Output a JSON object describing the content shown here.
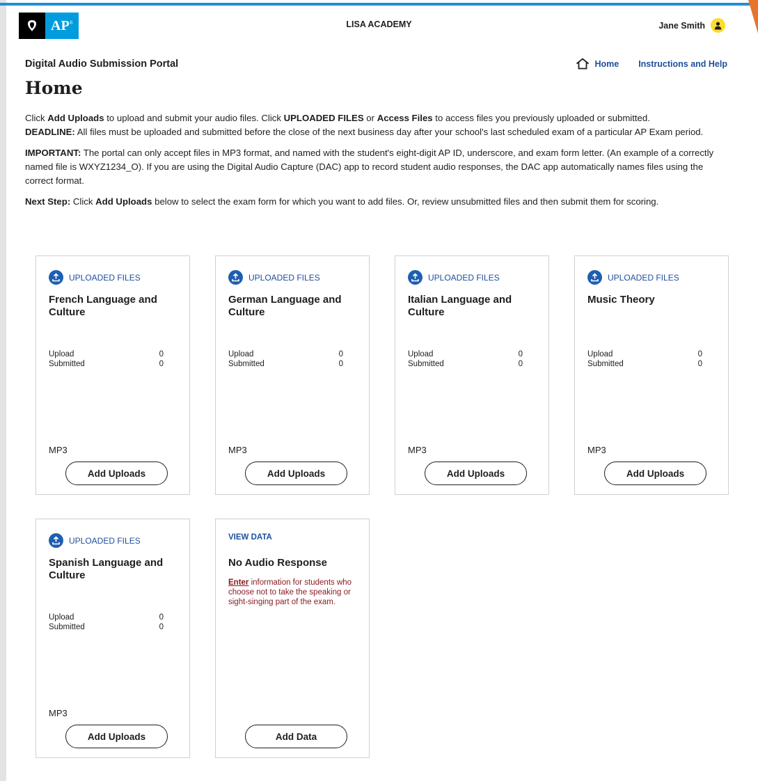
{
  "header": {
    "logo_ap": "AP",
    "logo_ap_mark": "®",
    "school": "LISA ACADEMY",
    "user_name": "Jane Smith",
    "avatar_icon": "user-icon"
  },
  "colors": {
    "top_bar": "#1d8fd8",
    "link": "#1f4e9d",
    "avatar": "#fddc2b",
    "tag_icon": "#1f5fb0",
    "description": "#8a1c24",
    "corner_accent": "#e8742c"
  },
  "portal_title": "Digital Audio Submission Portal",
  "nav": {
    "home": "Home",
    "help": "Instructions and Help"
  },
  "page_title": "Home",
  "intro": {
    "p1_a": "Click ",
    "p1_b": "Add Uploads",
    "p1_c": " to upload and submit your audio files. Click ",
    "p1_d": "UPLOADED FILES",
    "p1_e": " or ",
    "p1_f": "Access Files",
    "p1_g": " to access files you previously uploaded or submitted.",
    "p1_h": "DEADLINE:",
    "p1_i": " All files must be uploaded and submitted before the close of the next business day after your school's last scheduled exam of a particular AP Exam period.",
    "p2_a": "IMPORTANT:",
    "p2_b": " The portal can only accept files in MP3 format, and named with the student's eight-digit AP ID, underscore, and exam form letter. (An example of a correctly named file is WXYZ1234_O). If you are using the Digital Audio Capture (DAC) app to record student audio responses, the DAC app automatically names files using the correct format.",
    "p3_a": "Next Step:",
    "p3_b": " Click ",
    "p3_c": "Add Uploads",
    "p3_d": " below to select the exam form for which you want to add files. Or, review unsubmitted files and then submit them for scoring."
  },
  "cards": [
    {
      "tag": "UPLOADED FILES",
      "title": "French Language and Culture",
      "upload_label": "Upload",
      "upload_value": "0",
      "submitted_label": "Submitted",
      "submitted_value": "0",
      "format": "MP3",
      "button": "Add Uploads"
    },
    {
      "tag": "UPLOADED FILES",
      "title": "German Language and Culture",
      "upload_label": "Upload",
      "upload_value": "0",
      "submitted_label": "Submitted",
      "submitted_value": "0",
      "format": "MP3",
      "button": "Add Uploads"
    },
    {
      "tag": "UPLOADED FILES",
      "title": "Italian Language and Culture",
      "upload_label": "Upload",
      "upload_value": "0",
      "submitted_label": "Submitted",
      "submitted_value": "0",
      "format": "MP3",
      "button": "Add Uploads"
    },
    {
      "tag": "UPLOADED FILES",
      "title": "Music Theory",
      "upload_label": "Upload",
      "upload_value": "0",
      "submitted_label": "Submitted",
      "submitted_value": "0",
      "format": "MP3",
      "button": "Add Uploads"
    },
    {
      "tag": "UPLOADED FILES",
      "title": "Spanish Language and Culture",
      "upload_label": "Upload",
      "upload_value": "0",
      "submitted_label": "Submitted",
      "submitted_value": "0",
      "format": "MP3",
      "button": "Add Uploads"
    }
  ],
  "no_audio_card": {
    "tag": "VIEW DATA",
    "title": "No Audio Response",
    "desc_link": "Enter",
    "desc_rest": " information for students who choose not to take the speaking or sight-singing part of the exam.",
    "button": "Add Data"
  }
}
